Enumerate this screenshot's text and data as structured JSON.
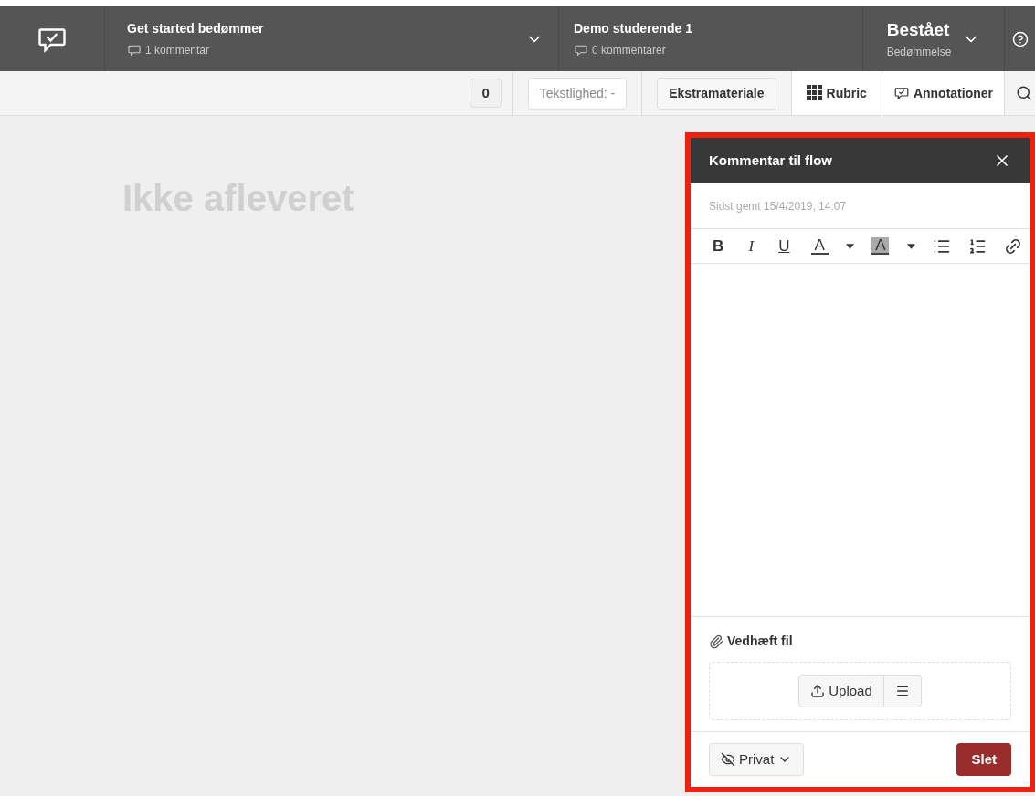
{
  "header": {
    "assignment": {
      "title": "Get started bedømmer",
      "comments": "1 kommentar"
    },
    "student": {
      "name": "Demo studerende 1",
      "comments": "0 kommentarer"
    },
    "grade": {
      "value": "Bestået",
      "label": "Bedømmelse"
    }
  },
  "toolbar": {
    "count": "0",
    "similarity": "Tekstlighed: -",
    "extra": "Ekstramateriale",
    "rubric": "Rubric",
    "annotations": "Annotationer"
  },
  "content": {
    "status": "Ikke afleveret"
  },
  "comment_panel": {
    "title": "Kommentar til flow",
    "highlighted": true,
    "saved": "Sidst gemt 15/4/2019, 14:07",
    "editor_tools": [
      {
        "kind": "bold",
        "label": "B"
      },
      {
        "kind": "italic",
        "label": "I"
      },
      {
        "kind": "underline",
        "label": "U"
      },
      {
        "kind": "color",
        "label": "A"
      },
      {
        "kind": "caret"
      },
      {
        "kind": "highlight",
        "label": "A"
      },
      {
        "kind": "caret"
      },
      {
        "kind": "bullets"
      },
      {
        "kind": "numbers"
      },
      {
        "kind": "link"
      }
    ],
    "attach_label": "Vedhæft fil",
    "upload": "Upload",
    "visibility": "Privat",
    "delete": "Slet"
  }
}
